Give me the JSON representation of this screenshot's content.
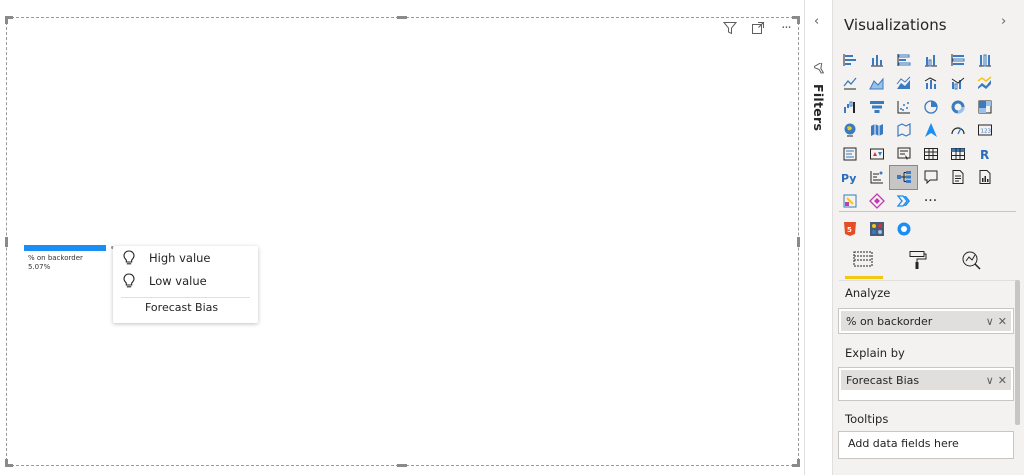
{
  "canvas": {
    "visual_header_icons": [
      "filter-icon",
      "focus-mode-icon",
      "more-options-icon"
    ],
    "more_options_text": "···",
    "key_driver": {
      "label": "% on backorder",
      "value": "5.07%",
      "bar_color": "#1a8ef2"
    },
    "popup": {
      "items": [
        {
          "icon": "lightbulb-icon",
          "label": "High value"
        },
        {
          "icon": "lightbulb-icon",
          "label": "Low value"
        }
      ],
      "field": "Forecast Bias"
    }
  },
  "filters": {
    "collapse_arrow": "‹",
    "label": "Filters"
  },
  "visualizations": {
    "title": "Visualizations",
    "expand_arrow": "›",
    "more_visuals": "···",
    "custom_visuals": [
      "html5-visual-icon",
      "custom-grid-visual-icon",
      "custom-circle-visual-icon"
    ],
    "tabs": [
      {
        "name": "fields-tab",
        "icon": "fields-icon",
        "active": true
      },
      {
        "name": "format-tab",
        "icon": "paint-roller-icon",
        "active": false
      },
      {
        "name": "analytics-tab",
        "icon": "analytics-icon",
        "active": false
      }
    ],
    "accent_color": "#f2c811",
    "analyze": {
      "label": "Analyze",
      "field": "% on backorder"
    },
    "explain_by": {
      "label": "Explain by",
      "field": "Forecast Bias"
    },
    "tooltips": {
      "label": "Tooltips",
      "placeholder": "Add data fields here"
    },
    "pill_chevron": "∨",
    "pill_remove": "✕"
  }
}
